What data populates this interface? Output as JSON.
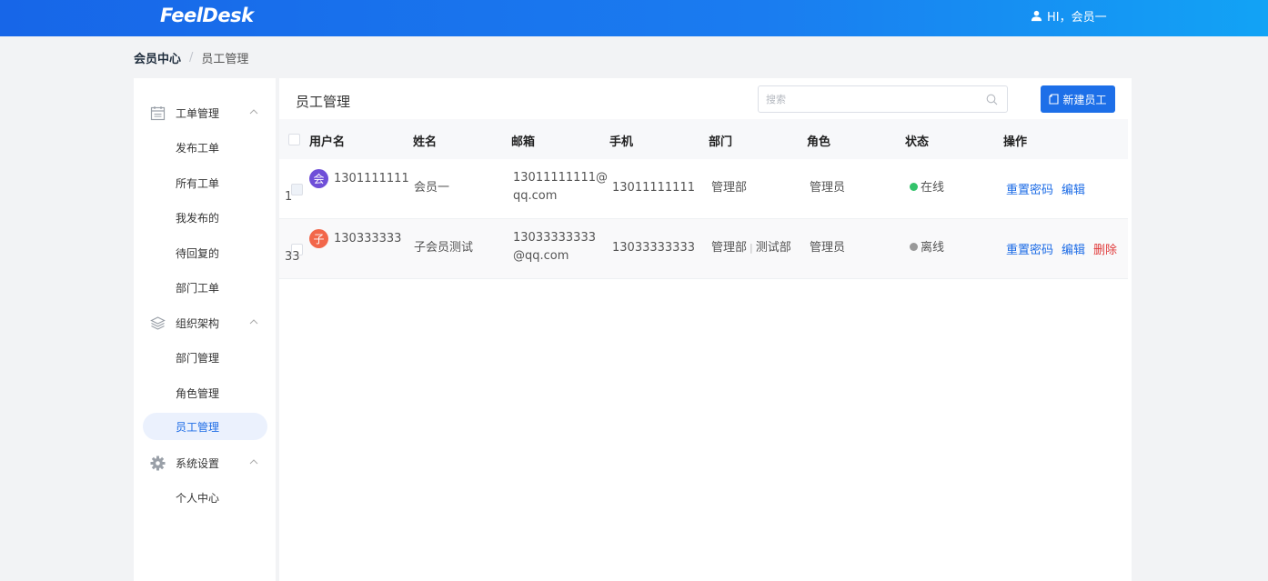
{
  "header": {
    "logo": "FeelDesk",
    "greeting": "HI，会员一"
  },
  "breadcrumb": {
    "home": "会员中心",
    "separator": "/",
    "current": "员工管理"
  },
  "sidebar": {
    "groups": [
      {
        "label": "工单管理",
        "icon": "calendar-icon",
        "items": [
          "发布工单",
          "所有工单",
          "我发布的",
          "待回复的",
          "部门工单"
        ]
      },
      {
        "label": "组织架构",
        "icon": "layers-icon",
        "items": [
          "部门管理",
          "角色管理",
          "员工管理"
        ]
      },
      {
        "label": "系统设置",
        "icon": "gear-icon",
        "items": [
          "个人中心"
        ]
      }
    ],
    "active_item": "员工管理"
  },
  "main": {
    "title": "员工管理",
    "search": {
      "placeholder": "搜索",
      "value": ""
    },
    "new_button": "新建员工",
    "table": {
      "columns": [
        "用户名",
        "姓名",
        "邮箱",
        "手机",
        "部门",
        "角色",
        "状态",
        "操作"
      ],
      "rows": [
        {
          "avatar_char": "会",
          "avatar_color": "#6f4fd8",
          "username_line1": "1301111111",
          "username_line2": "1",
          "name": "会员一",
          "email_line1": "13011111111@",
          "email_line2": "qq.com",
          "phone": "13011111111",
          "dept": "管理部",
          "dept2": "",
          "role": "管理员",
          "status": "在线",
          "status_color": "#33c36b",
          "actions": [
            "重置密码",
            "编辑"
          ]
        },
        {
          "avatar_char": "子",
          "avatar_color": "#f2674a",
          "username_line1": "130333333",
          "username_line2": "33",
          "name": "子会员测试",
          "email_line1": "13033333333",
          "email_line2": "@qq.com",
          "phone": "13033333333",
          "dept": "管理部",
          "dept2": "测试部",
          "role": "管理员",
          "status": "离线",
          "status_color": "#999999",
          "actions": [
            "重置密码",
            "编辑",
            "删除"
          ]
        }
      ]
    }
  }
}
